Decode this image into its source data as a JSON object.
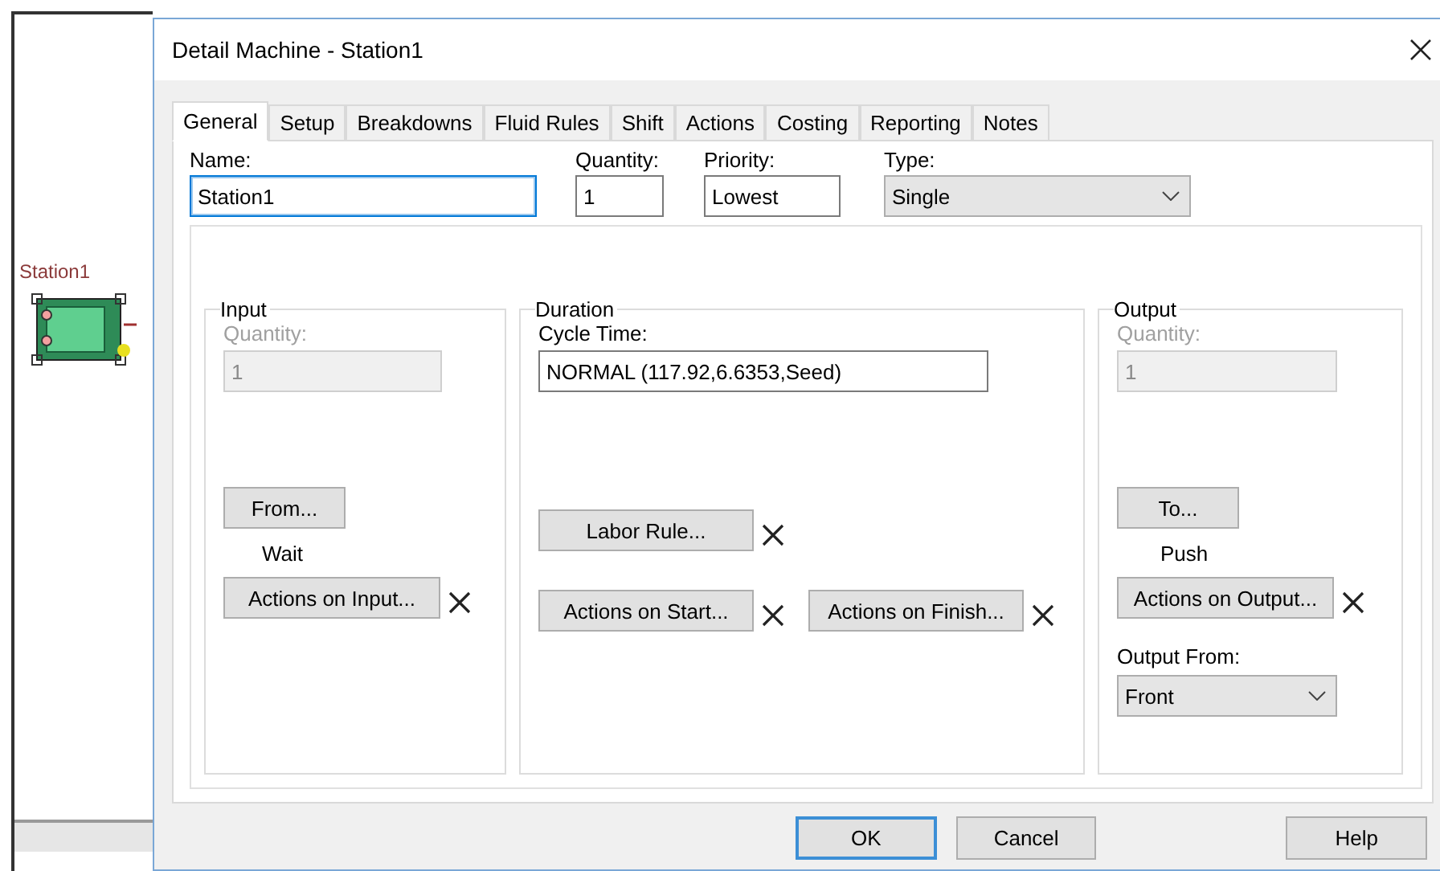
{
  "canvas": {
    "station_label": "Station1"
  },
  "window": {
    "title": "Detail Machine - Station1"
  },
  "tabs": [
    {
      "label": "General",
      "selected": true
    },
    {
      "label": "Setup",
      "selected": false
    },
    {
      "label": "Breakdowns",
      "selected": false
    },
    {
      "label": "Fluid Rules",
      "selected": false
    },
    {
      "label": "Shift",
      "selected": false
    },
    {
      "label": "Actions",
      "selected": false
    },
    {
      "label": "Costing",
      "selected": false
    },
    {
      "label": "Reporting",
      "selected": false
    },
    {
      "label": "Notes",
      "selected": false
    }
  ],
  "fields": [
    {
      "label": "Name:",
      "value": "Station1",
      "kind": "text",
      "focused": true
    },
    {
      "label": "Quantity:",
      "value": "1",
      "kind": "text",
      "focused": false
    },
    {
      "label": "Priority:",
      "value": "Lowest",
      "kind": "text",
      "focused": false
    },
    {
      "label": "Type:",
      "value": "Single",
      "kind": "select",
      "focused": false
    }
  ],
  "input": {
    "title": "Input",
    "quantity": {
      "label": "Quantity:",
      "value": "1",
      "disabled": true
    },
    "from_button": "From...",
    "mode": "Wait",
    "actions_button": "Actions on Input..."
  },
  "duration": {
    "title": "Duration",
    "cycle_time": {
      "label": "Cycle Time:",
      "value": "NORMAL (117.92,6.6353,Seed)"
    },
    "labor_button": "Labor Rule...",
    "start_button": "Actions on Start...",
    "finish_button": "Actions on Finish..."
  },
  "output": {
    "title": "Output",
    "quantity": {
      "label": "Quantity:",
      "value": "1",
      "disabled": true
    },
    "to_button": "To...",
    "mode": "Push",
    "actions_button": "Actions on Output...",
    "output_from": {
      "label": "Output From:",
      "value": "Front"
    }
  },
  "buttons": [
    {
      "label": "OK",
      "default": true
    },
    {
      "label": "Cancel",
      "default": false
    },
    {
      "label": "Help",
      "default": false
    }
  ]
}
